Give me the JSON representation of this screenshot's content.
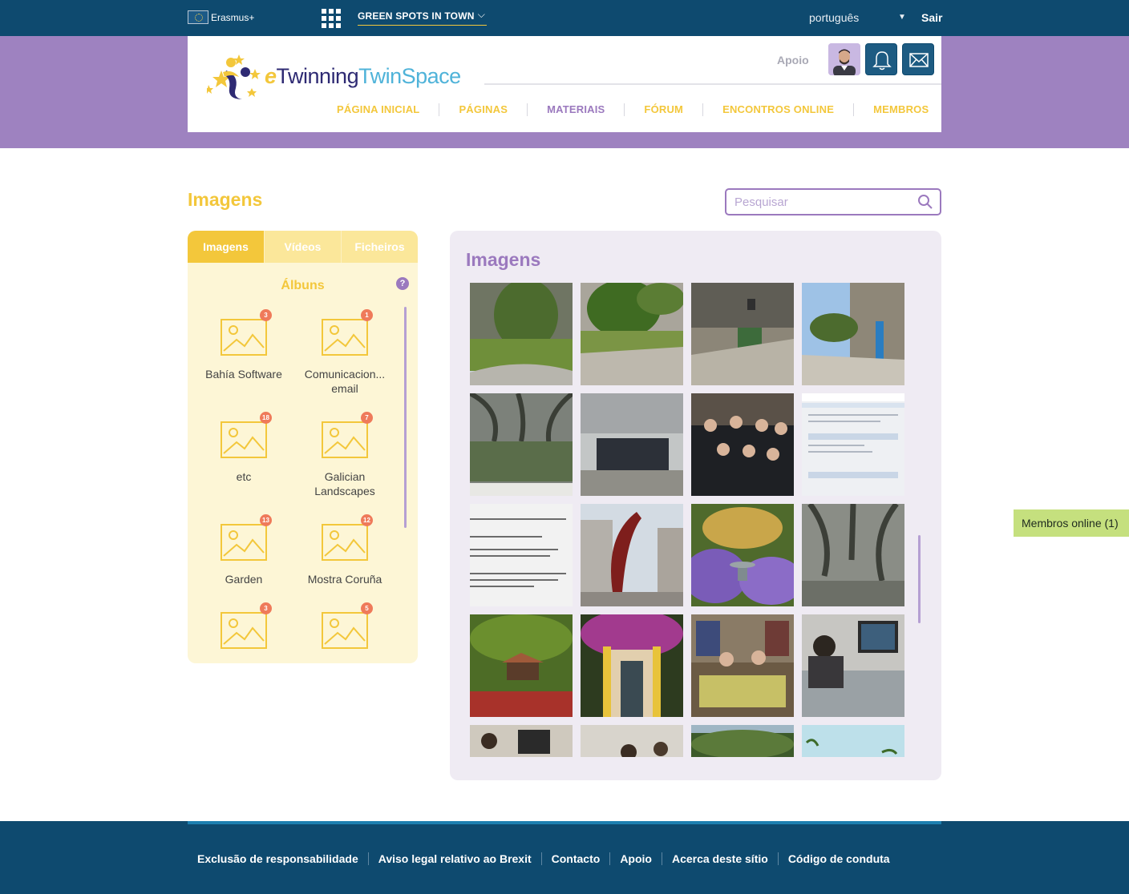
{
  "topbar": {
    "program": "Erasmus+",
    "project": "GREEN SPOTS IN TOWN",
    "language": "português",
    "logout": "Sair"
  },
  "header": {
    "logo_prefix": "e",
    "logo_twinning": "Twinning",
    "logo_twinspace": "TwinSpace",
    "support": "Apoio",
    "nav": [
      "PÁGINA INICIAL",
      "PÁGINAS",
      "MATERIAIS",
      "FÓRUM",
      "ENCONTROS ONLINE",
      "MEMBROS"
    ],
    "active_nav": "MATERIAIS"
  },
  "main": {
    "title": "Imagens",
    "search_placeholder": "Pesquisar"
  },
  "left": {
    "tabs": [
      "Imagens",
      "Vídeos",
      "Ficheiros"
    ],
    "active_tab": "Imagens",
    "albums_title": "Álbuns",
    "help": "?",
    "albums": [
      {
        "label": "Bahía Software",
        "count": "3"
      },
      {
        "label": "Comunicacion... email",
        "count": "1"
      },
      {
        "label": "etc",
        "count": "18"
      },
      {
        "label": "Galician Landscapes",
        "count": "7"
      },
      {
        "label": "Garden",
        "count": "13"
      },
      {
        "label": "Mostra Coruña",
        "count": "12"
      },
      {
        "label": "",
        "count": "3"
      },
      {
        "label": "",
        "count": "5"
      }
    ]
  },
  "gallery": {
    "title": "Imagens"
  },
  "online": "Membros online (1)",
  "footer": {
    "links": [
      "Exclusão de responsabilidade",
      "Aviso legal relativo ao Brexit",
      "Contacto",
      "Apoio",
      "Acerca deste sítio",
      "Código de conduta"
    ]
  },
  "colors": {
    "topbar": "#0e4a6f",
    "band": "#9e82c0",
    "accent_yellow": "#f3c73b",
    "accent_purple": "#9b79be",
    "online_tab": "#c5e07e"
  }
}
